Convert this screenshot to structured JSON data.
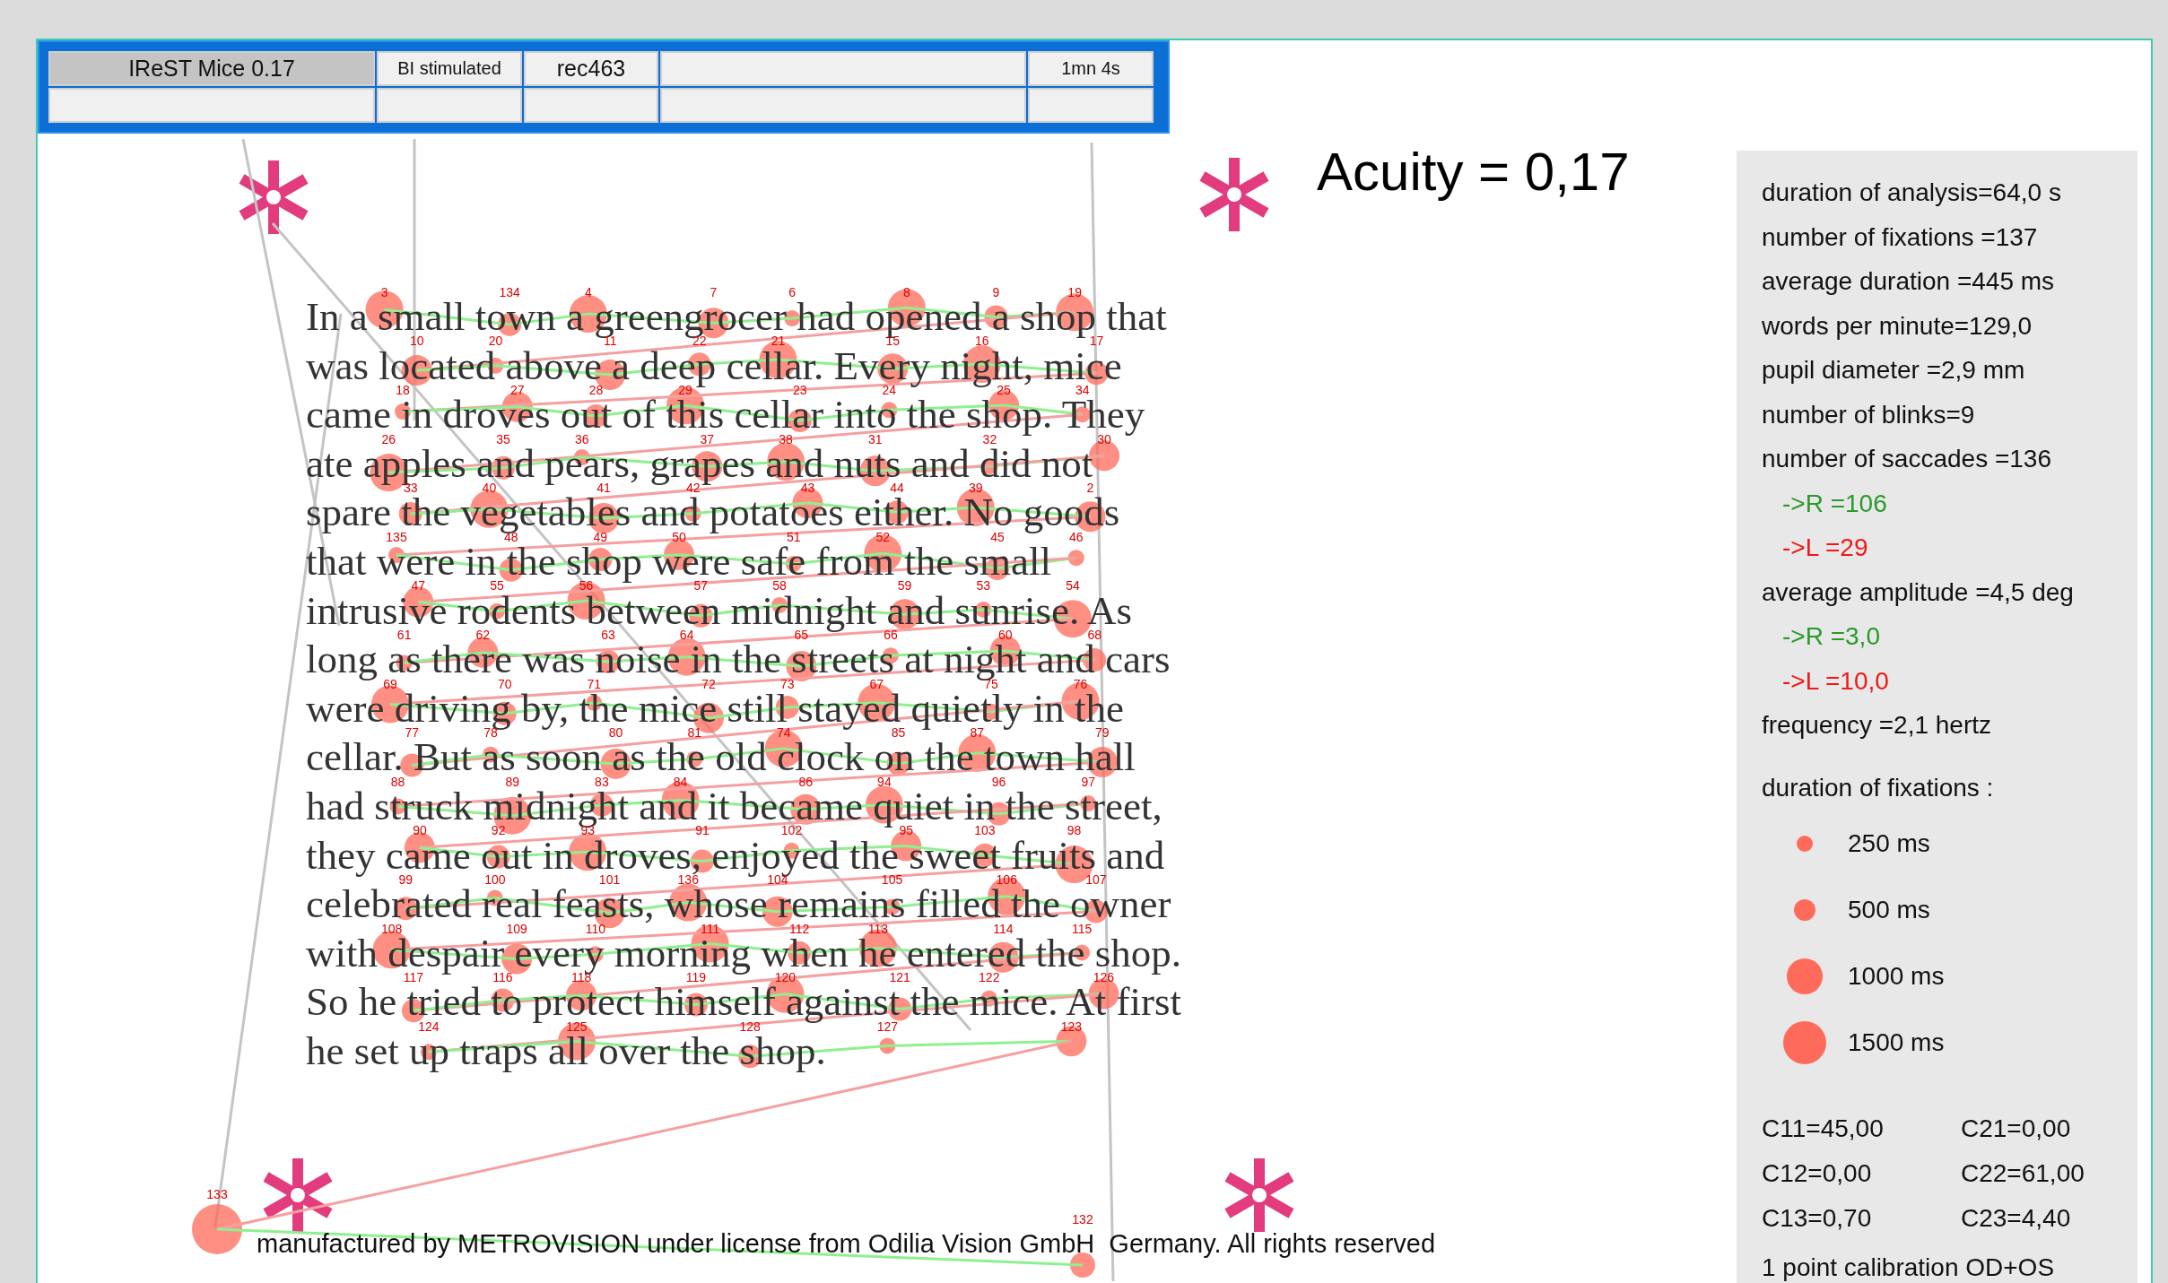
{
  "header": {
    "cells": [
      {
        "text": "IReST Mice 0.17",
        "selected": true
      },
      {
        "text": "BI stimulated",
        "selected": false
      },
      {
        "text": "rec463",
        "selected": false
      },
      {
        "selected": false
      },
      {
        "text": "1mn 4s",
        "selected": false
      }
    ]
  },
  "acuity": "Acuity = 0,17",
  "text_lines": [
    "In a small town a greengrocer had opened a shop that",
    "was located above a deep cellar. Every night, mice",
    "came in droves out of this cellar into the shop. They",
    "ate apples and pears, grapes and nuts and did not",
    "spare the vegetables and potatoes either. No goods",
    "that were in the shop were safe from the small",
    "intrusive rodents between midnight and sunrise. As",
    "long as there was noise in the streets at night and cars",
    "were driving by, the mice still stayed quietly in the",
    "cellar. But as soon as the old clock on the town hall",
    "had struck midnight and it became quiet in the street,",
    "they came out in droves, enjoyed the sweet fruits and",
    "celebrated real feasts, whose remains filled the owner",
    "with despair every morning when he entered the shop.",
    "So he tried to protect himself against the mice. At first",
    "he set up traps all over the shop."
  ],
  "fixations": [
    {
      "label": "3",
      "kind": "text"
    },
    {
      "label": "134",
      "kind": "text"
    },
    {
      "label": "4",
      "kind": "text"
    },
    {
      "label": "7",
      "kind": "text"
    },
    {
      "label": "6",
      "kind": "text"
    },
    {
      "label": "8",
      "kind": "text"
    },
    {
      "label": "9",
      "kind": "text"
    },
    {
      "label": "19",
      "kind": "text"
    },
    {
      "label": "10",
      "kind": "text"
    },
    {
      "label": "20",
      "kind": "text"
    },
    {
      "label": "11",
      "kind": "text"
    },
    {
      "label": "22",
      "kind": "text"
    },
    {
      "label": "21",
      "kind": "text"
    },
    {
      "label": "15",
      "kind": "text"
    },
    {
      "label": "16",
      "kind": "text"
    },
    {
      "label": "17",
      "kind": "text"
    },
    {
      "label": "18",
      "kind": "text"
    },
    {
      "label": "27",
      "kind": "text"
    },
    {
      "label": "28",
      "kind": "text"
    },
    {
      "label": "29",
      "kind": "text"
    },
    {
      "label": "23",
      "kind": "text"
    },
    {
      "label": "24",
      "kind": "text"
    },
    {
      "label": "25",
      "kind": "text"
    },
    {
      "label": "34",
      "kind": "text"
    },
    {
      "label": "26",
      "kind": "text"
    },
    {
      "label": "35",
      "kind": "text"
    },
    {
      "label": "36",
      "kind": "text"
    },
    {
      "label": "37",
      "kind": "text"
    },
    {
      "label": "38",
      "kind": "text"
    },
    {
      "label": "31",
      "kind": "text"
    },
    {
      "label": "32",
      "kind": "text"
    },
    {
      "label": "30",
      "kind": "text"
    },
    {
      "label": "33",
      "kind": "text"
    },
    {
      "label": "40",
      "kind": "text"
    },
    {
      "label": "41",
      "kind": "text"
    },
    {
      "label": "42",
      "kind": "text"
    },
    {
      "label": "43",
      "kind": "text"
    },
    {
      "label": "44",
      "kind": "text"
    },
    {
      "label": "39",
      "kind": "text"
    },
    {
      "label": "2",
      "kind": "text"
    },
    {
      "label": "135",
      "kind": "text"
    },
    {
      "label": "48",
      "kind": "text"
    },
    {
      "label": "49",
      "kind": "text"
    },
    {
      "label": "50",
      "kind": "text"
    },
    {
      "label": "51",
      "kind": "text"
    },
    {
      "label": "52",
      "kind": "text"
    },
    {
      "label": "45",
      "kind": "text"
    },
    {
      "label": "46",
      "kind": "text"
    },
    {
      "label": "47",
      "kind": "text"
    },
    {
      "label": "55",
      "kind": "text"
    },
    {
      "label": "56",
      "kind": "text"
    },
    {
      "label": "57",
      "kind": "text"
    },
    {
      "label": "58",
      "kind": "text"
    },
    {
      "label": "59",
      "kind": "text"
    },
    {
      "label": "53",
      "kind": "text"
    },
    {
      "label": "54",
      "kind": "text"
    },
    {
      "label": "61",
      "kind": "text"
    },
    {
      "label": "62",
      "kind": "text"
    },
    {
      "label": "63",
      "kind": "text"
    },
    {
      "label": "64",
      "kind": "text"
    },
    {
      "label": "65",
      "kind": "text"
    },
    {
      "label": "66",
      "kind": "text"
    },
    {
      "label": "60",
      "kind": "text"
    },
    {
      "label": "68",
      "kind": "text"
    },
    {
      "label": "69",
      "kind": "text"
    },
    {
      "label": "70",
      "kind": "text"
    },
    {
      "label": "71",
      "kind": "text"
    },
    {
      "label": "72",
      "kind": "text"
    },
    {
      "label": "73",
      "kind": "text"
    },
    {
      "label": "67",
      "kind": "text"
    },
    {
      "label": "75",
      "kind": "text"
    },
    {
      "label": "76",
      "kind": "text"
    },
    {
      "label": "77",
      "kind": "text"
    },
    {
      "label": "78",
      "kind": "text"
    },
    {
      "label": "80",
      "kind": "text"
    },
    {
      "label": "81",
      "kind": "text"
    },
    {
      "label": "74",
      "kind": "text"
    },
    {
      "label": "85",
      "kind": "text"
    },
    {
      "label": "87",
      "kind": "text"
    },
    {
      "label": "79",
      "kind": "text"
    },
    {
      "label": "88",
      "kind": "text"
    },
    {
      "label": "89",
      "kind": "text"
    },
    {
      "label": "83",
      "kind": "text"
    },
    {
      "label": "84",
      "kind": "text"
    },
    {
      "label": "86",
      "kind": "text"
    },
    {
      "label": "94",
      "kind": "text"
    },
    {
      "label": "96",
      "kind": "text"
    },
    {
      "label": "97",
      "kind": "text"
    },
    {
      "label": "90",
      "kind": "text"
    },
    {
      "label": "92",
      "kind": "text"
    },
    {
      "label": "93",
      "kind": "text"
    },
    {
      "label": "91",
      "kind": "text"
    },
    {
      "label": "102",
      "kind": "text"
    },
    {
      "label": "95",
      "kind": "text"
    },
    {
      "label": "103",
      "kind": "text"
    },
    {
      "label": "98",
      "kind": "text"
    },
    {
      "label": "99",
      "kind": "text"
    },
    {
      "label": "100",
      "kind": "text"
    },
    {
      "label": "101",
      "kind": "text"
    },
    {
      "label": "136",
      "kind": "text"
    },
    {
      "label": "104",
      "kind": "text"
    },
    {
      "label": "105",
      "kind": "text"
    },
    {
      "label": "106",
      "kind": "text"
    },
    {
      "label": "107",
      "kind": "text"
    },
    {
      "label": "108",
      "kind": "text"
    },
    {
      "label": "109",
      "kind": "text"
    },
    {
      "label": "110",
      "kind": "text"
    },
    {
      "label": "111",
      "kind": "text"
    },
    {
      "label": "112",
      "kind": "text"
    },
    {
      "label": "113",
      "kind": "text"
    },
    {
      "label": "114",
      "kind": "text"
    },
    {
      "label": "115",
      "kind": "text"
    },
    {
      "label": "117",
      "kind": "text"
    },
    {
      "label": "116",
      "kind": "text"
    },
    {
      "label": "118",
      "kind": "text"
    },
    {
      "label": "119",
      "kind": "text"
    },
    {
      "label": "120",
      "kind": "text"
    },
    {
      "label": "121",
      "kind": "text"
    },
    {
      "label": "122",
      "kind": "text"
    },
    {
      "label": "126",
      "kind": "text"
    },
    {
      "label": "124",
      "kind": "text"
    },
    {
      "label": "125",
      "kind": "text"
    },
    {
      "label": "128",
      "kind": "text"
    },
    {
      "label": "127",
      "kind": "text"
    },
    {
      "label": "123",
      "kind": "text"
    },
    {
      "label": "133",
      "kind": "outside"
    },
    {
      "label": "132",
      "kind": "outside"
    }
  ],
  "footer": "manufactured by METROVISION under license from Odilia Vision GmbH  Germany. All rights reserved",
  "stats": [
    {
      "text": "duration of analysis=64,0 s",
      "kind": "plain"
    },
    {
      "text": "number of fixations =137",
      "kind": "plain"
    },
    {
      "text": "average duration =445 ms",
      "kind": "plain"
    },
    {
      "text": "words per minute=129,0",
      "kind": "plain"
    },
    {
      "text": "pupil diameter =2,9 mm",
      "kind": "plain"
    },
    {
      "text": "number of blinks=9",
      "kind": "plain"
    },
    {
      "text": "number of saccades =136",
      "kind": "plain"
    },
    {
      "text": "->R =106",
      "kind": "right"
    },
    {
      "text": "->L =29",
      "kind": "left"
    },
    {
      "text": "average amplitude =4,5 deg",
      "kind": "plain"
    },
    {
      "text": "->R =3,0",
      "kind": "right"
    },
    {
      "text": "->L =10,0",
      "kind": "left"
    },
    {
      "text": "frequency =2,1 hertz",
      "kind": "plain"
    }
  ],
  "legend": {
    "title": "duration of fixations :",
    "items": [
      "250 ms",
      "500 ms",
      "1000 ms",
      "1500 ms"
    ]
  },
  "coefficients": [
    "C11=45,00",
    "C21=0,00",
    "C12=0,00",
    "C22=61,00",
    "C13=0,70",
    "C23=4,40"
  ],
  "calibration": "1 point calibration OD+OS"
}
